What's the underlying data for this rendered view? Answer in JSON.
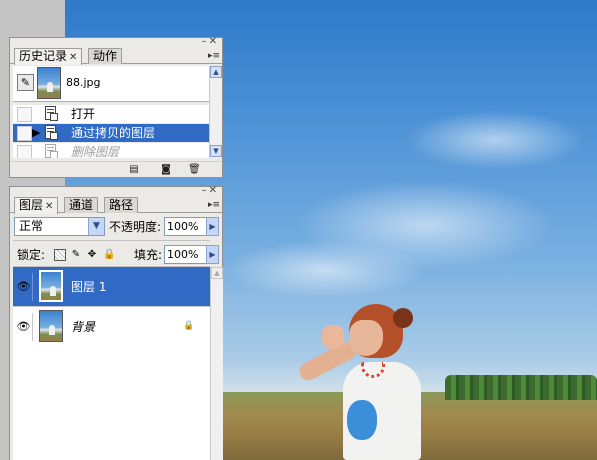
{
  "history_panel": {
    "tabs": [
      {
        "label": "历史记录",
        "active": true,
        "closable": true
      },
      {
        "label": "动作",
        "active": false,
        "closable": false
      }
    ],
    "snapshot": {
      "label": "88.jpg"
    },
    "rows": [
      {
        "label": "打开",
        "state": "normal"
      },
      {
        "label": "通过拷贝的图层",
        "state": "selected"
      },
      {
        "label": "删除图层",
        "state": "future"
      }
    ],
    "footer_icons": [
      "new-document-from-state-icon",
      "new-snapshot-icon",
      "trash-icon"
    ]
  },
  "layers_panel": {
    "tabs": [
      {
        "label": "图层",
        "active": true,
        "closable": true
      },
      {
        "label": "通道",
        "active": false,
        "closable": false
      },
      {
        "label": "路径",
        "active": false,
        "closable": false
      }
    ],
    "blend_mode": "正常",
    "opacity_label": "不透明度:",
    "opacity_value": "100%",
    "lock_label": "锁定:",
    "fill_label": "填充:",
    "fill_value": "100%",
    "layers": [
      {
        "name": "图层 1",
        "selected": true,
        "visible": true,
        "locked": false
      },
      {
        "name": "背景",
        "selected": false,
        "visible": true,
        "locked": true
      }
    ]
  },
  "colors": {
    "selection": "#316ac5",
    "panel_bg": "#ebeae6",
    "sky_top": "#2f79c8"
  }
}
